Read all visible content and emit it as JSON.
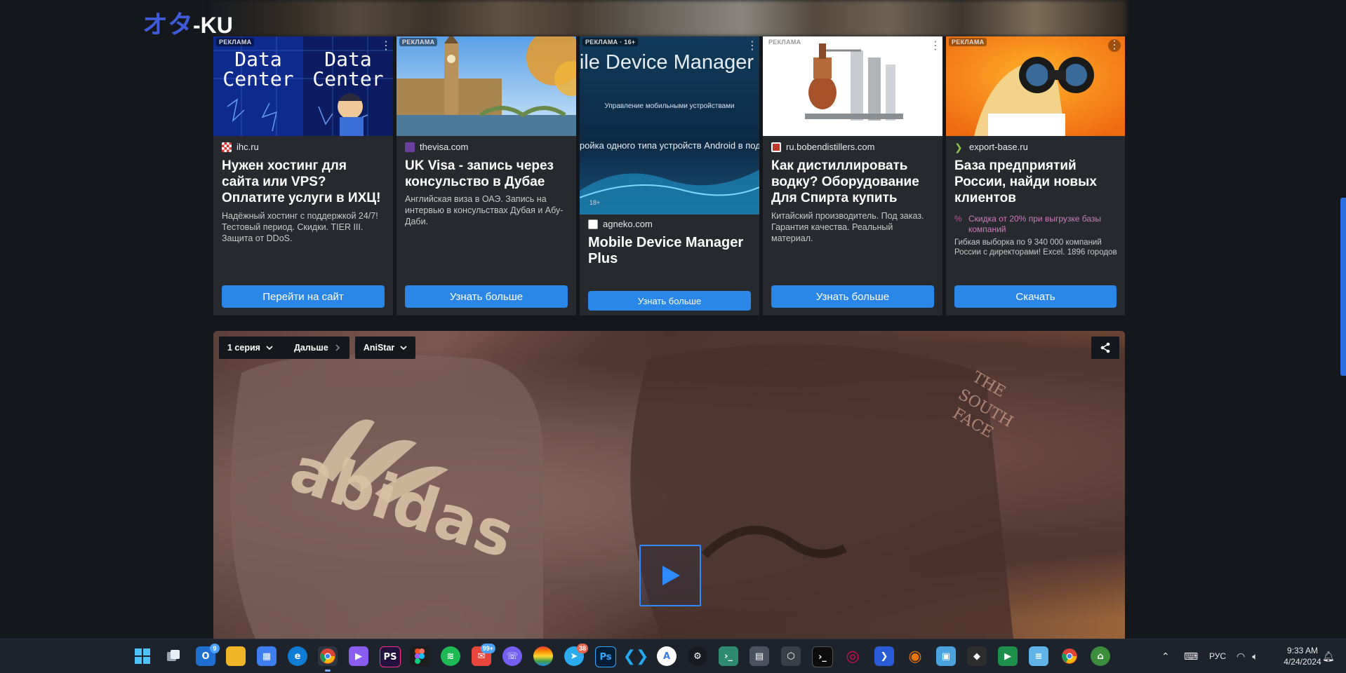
{
  "site": {
    "logo_jp": "オタ",
    "logo_en": "-KU"
  },
  "ads": [
    {
      "label": "РЕКЛАМА",
      "image": "data-center-anime-art",
      "domain": "ihc.ru",
      "title": "Нужен хостинг для сайта или VPS? Оплатите услуги в ИХЦ!",
      "description": "Надёжный хостинг с поддержкой 24/7! Тестовый период. Скидки. TIER III. Защита от DDoS.",
      "button": "Перейти на сайт",
      "image_text": [
        "Data",
        "Center",
        "Data",
        "Center"
      ]
    },
    {
      "label": "РЕКЛАМА",
      "image": "london-big-ben-photo",
      "domain": "thevisa.com",
      "title": "UK Visa - запись через консульство в Дубае",
      "description": "Английская виза в ОАЭ. Запись на интервью в консульствах Дубая и Абу-Даби.",
      "button": "Узнать больше"
    },
    {
      "label": "РЕКЛАМА · 16+",
      "image": "mobile-device-manager-banner",
      "image_title": "Mobile Device Manager Plus",
      "image_subtitle": "Управление мобильными устройствами",
      "image_text": "Настройка одного типа устройств Android в подарок",
      "image_age": "18+",
      "domain": "agneko.com",
      "title": "Mobile Device Manager Plus",
      "button": "Узнать больше"
    },
    {
      "label": "РЕКЛАМА",
      "image": "distillery-equipment-photo",
      "domain": "ru.bobendistillers.com",
      "title": "Как дистиллировать водку? Оборудование Для Спирта купить",
      "description": "Китайский производитель. Под заказ. Гарантия качества. Реальный материал.",
      "button": "Узнать больше"
    },
    {
      "label": "РЕКЛАМА",
      "image": "woman-binoculars-photo",
      "domain": "export-base.ru",
      "title": "База предприятий России, найди новых клиентов",
      "promo": "Скидка от 20% при выгрузке базы компаний",
      "description": "Гибкая выборка по 9 340 000 компаний России с директорами! Excel. 1896 городов",
      "button": "Скачать"
    }
  ],
  "player": {
    "episode_select": "1 серия",
    "next_label": "Дальше",
    "voice_select": "AniStar",
    "frame_text_left": "abidas",
    "frame_text_right": [
      "THE",
      "SOUTH",
      "FACE"
    ]
  },
  "taskbar": {
    "badges": {
      "outlook": "9",
      "mail": "99+",
      "telegram": "38"
    },
    "language": "РУС",
    "time": "9:33 AM",
    "date": "4/24/2024"
  },
  "colors": {
    "page_bg": "#14171b",
    "card_bg": "#26292e",
    "accent_blue": "#2a86e7",
    "logo_blue": "#3f5bd9",
    "taskbar_bg": "#1d232c"
  }
}
